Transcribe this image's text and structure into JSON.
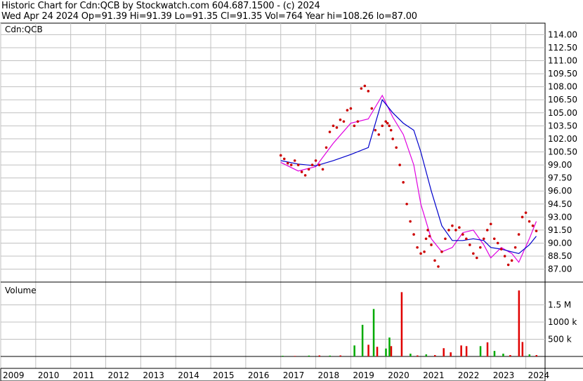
{
  "header": {
    "line1": "Historic Chart for Cdn:QCB by Stockwatch.com 604.687.1500 - (c) 2024",
    "line2": "Wed Apr 24 2024   Op=91.39   Hi=91.39   Lo=91.35   Cl=91.35   Vol=764   Year hi=108.26   lo=87.00"
  },
  "colors": {
    "grid": "#c0c0c0",
    "up": "#00aa00",
    "down": "#e00000",
    "ma_short": "#e000e0",
    "ma_long": "#0000cc",
    "price_dot": "#cc0000"
  },
  "chart_data": [
    {
      "type": "scatter",
      "title": "Cdn:QCB",
      "ylim": [
        86,
        115
      ],
      "yticks": [
        "114.00",
        "112.50",
        "111.00",
        "109.50",
        "108.00",
        "106.50",
        "105.00",
        "103.50",
        "102.00",
        "100.50",
        "99.00",
        "97.50",
        "96.00",
        "94.50",
        "93.00",
        "91.50",
        "90.00",
        "88.50",
        "87.00"
      ],
      "xlim": [
        2009,
        2024.55
      ],
      "x_labels": [
        "2009",
        "2010",
        "2011",
        "2012",
        "2013",
        "2014",
        "2015",
        "2016",
        "2017",
        "2018",
        "2019",
        "2020",
        "2021",
        "2022",
        "2023",
        "2024"
      ],
      "series": [
        {
          "name": "",
          "x": [
            2017.0,
            2017.1,
            2017.2,
            2017.3,
            2017.4,
            2017.5,
            2017.6,
            2017.7,
            2017.8,
            2017.9,
            2018.0,
            2018.1,
            2018.2,
            2018.3,
            2018.4,
            2018.5,
            2018.6,
            2018.7,
            2018.8,
            2018.9,
            2019.0,
            2019.1,
            2019.2,
            2019.3,
            2019.4,
            2019.5,
            2019.6,
            2019.7,
            2019.8,
            2019.9,
            2020.0,
            2020.05,
            2020.1,
            2020.15,
            2020.2,
            2020.3,
            2020.4,
            2020.5,
            2020.6,
            2020.7,
            2020.8,
            2020.9,
            2021.0,
            2021.1,
            2021.15,
            2021.2,
            2021.25,
            2021.3,
            2021.4,
            2021.5,
            2021.6,
            2021.7,
            2021.8,
            2021.9,
            2022.0,
            2022.1,
            2022.2,
            2022.3,
            2022.4,
            2022.5,
            2022.6,
            2022.7,
            2022.8,
            2022.9,
            2023.0,
            2023.1,
            2023.2,
            2023.3,
            2023.4,
            2023.5,
            2023.6,
            2023.7,
            2023.8,
            2023.9,
            2024.0,
            2024.1,
            2024.2,
            2024.3
          ],
          "y": [
            100.1,
            99.7,
            99.2,
            99.0,
            99.5,
            99.0,
            98.2,
            97.8,
            98.5,
            99.0,
            99.5,
            99.0,
            98.5,
            101.0,
            102.8,
            103.5,
            103.3,
            104.2,
            104.0,
            105.3,
            105.5,
            103.5,
            104.0,
            107.8,
            108.1,
            107.5,
            105.5,
            103.0,
            102.5,
            103.5,
            104.0,
            103.8,
            103.5,
            103.0,
            102.0,
            101.0,
            99.0,
            97.0,
            94.5,
            92.5,
            91.0,
            89.5,
            88.8,
            89.0,
            90.5,
            91.5,
            90.8,
            89.8,
            88.0,
            87.3,
            89.0,
            90.5,
            91.5,
            92.0,
            91.5,
            91.8,
            91.0,
            90.5,
            89.8,
            88.8,
            88.3,
            89.5,
            90.5,
            91.5,
            92.2,
            90.5,
            90.0,
            89.3,
            88.5,
            87.5,
            88.0,
            89.5,
            91.0,
            93.0,
            93.5,
            92.5,
            92.0,
            91.4
          ]
        },
        {
          "name": "",
          "x": [
            2017.0,
            2017.5,
            2018.0,
            2018.5,
            2019.0,
            2019.5,
            2019.9,
            2020.2,
            2020.5,
            2020.8,
            2021.0,
            2021.3,
            2021.6,
            2021.9,
            2022.2,
            2022.5,
            2022.8,
            2023.0,
            2023.3,
            2023.6,
            2023.8,
            2024.1,
            2024.3
          ],
          "y": [
            99.3,
            98.3,
            98.8,
            101.5,
            103.8,
            104.3,
            107.0,
            104.5,
            102.5,
            99.0,
            94.5,
            90.5,
            89.0,
            89.5,
            91.2,
            91.5,
            89.8,
            88.3,
            89.5,
            88.8,
            87.8,
            90.5,
            92.5
          ]
        },
        {
          "name": "",
          "x": [
            2017.0,
            2017.5,
            2018.0,
            2018.5,
            2019.0,
            2019.5,
            2019.9,
            2020.2,
            2020.5,
            2020.8,
            2021.0,
            2021.3,
            2021.6,
            2021.9,
            2022.2,
            2022.5,
            2022.8,
            2023.0,
            2023.3,
            2023.6,
            2023.8,
            2024.1,
            2024.3
          ],
          "y": [
            99.5,
            99.1,
            98.9,
            99.5,
            100.2,
            101.0,
            106.5,
            105.0,
            103.8,
            103.0,
            100.5,
            96.0,
            92.0,
            90.3,
            90.3,
            90.5,
            90.3,
            89.5,
            89.3,
            89.0,
            88.8,
            89.8,
            90.8
          ]
        }
      ]
    },
    {
      "type": "bar",
      "title": "Volume",
      "ylim": [
        0,
        2000000
      ],
      "yticks": [
        "1.5 M",
        "1000 k",
        "500 k"
      ],
      "bars": [
        {
          "x": 2017.05,
          "v": 20000,
          "up": true
        },
        {
          "x": 2017.4,
          "v": 15000,
          "up": false
        },
        {
          "x": 2017.8,
          "v": 25000,
          "up": true
        },
        {
          "x": 2018.1,
          "v": 30000,
          "up": false
        },
        {
          "x": 2018.4,
          "v": 25000,
          "up": true
        },
        {
          "x": 2018.7,
          "v": 30000,
          "up": false
        },
        {
          "x": 2019.1,
          "v": 320000,
          "up": true
        },
        {
          "x": 2019.33,
          "v": 920000,
          "up": true
        },
        {
          "x": 2019.5,
          "v": 340000,
          "up": false
        },
        {
          "x": 2019.65,
          "v": 1380000,
          "up": true
        },
        {
          "x": 2019.75,
          "v": 280000,
          "up": false
        },
        {
          "x": 2020.0,
          "v": 230000,
          "up": true
        },
        {
          "x": 2020.1,
          "v": 550000,
          "up": true
        },
        {
          "x": 2020.15,
          "v": 300000,
          "up": false
        },
        {
          "x": 2020.45,
          "v": 1870000,
          "up": false
        },
        {
          "x": 2020.7,
          "v": 80000,
          "up": true
        },
        {
          "x": 2020.9,
          "v": 30000,
          "up": false
        },
        {
          "x": 2021.15,
          "v": 60000,
          "up": true
        },
        {
          "x": 2021.4,
          "v": 40000,
          "up": false
        },
        {
          "x": 2021.65,
          "v": 240000,
          "up": false
        },
        {
          "x": 2021.85,
          "v": 120000,
          "up": false
        },
        {
          "x": 2022.15,
          "v": 320000,
          "up": false
        },
        {
          "x": 2022.3,
          "v": 300000,
          "up": false
        },
        {
          "x": 2022.7,
          "v": 300000,
          "up": true
        },
        {
          "x": 2022.9,
          "v": 410000,
          "up": false
        },
        {
          "x": 2023.1,
          "v": 160000,
          "up": true
        },
        {
          "x": 2023.35,
          "v": 80000,
          "up": true
        },
        {
          "x": 2023.55,
          "v": 40000,
          "up": false
        },
        {
          "x": 2023.8,
          "v": 1920000,
          "up": false
        },
        {
          "x": 2023.9,
          "v": 420000,
          "up": false
        },
        {
          "x": 2024.1,
          "v": 60000,
          "up": true
        },
        {
          "x": 2024.3,
          "v": 40000,
          "up": false
        }
      ]
    }
  ]
}
